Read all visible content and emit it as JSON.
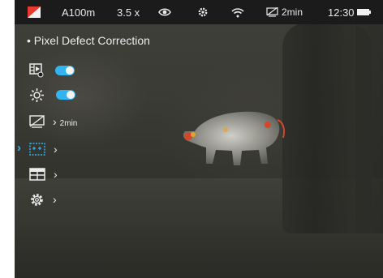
{
  "status_bar": {
    "model": "A100m",
    "zoom": "3.5 x",
    "timer": "2min",
    "clock": "12:30",
    "icons": [
      "palette-icon",
      "eye-icon",
      "gear-icon",
      "wifi-icon",
      "display-off-icon",
      "battery-icon"
    ]
  },
  "menu": {
    "title": "• Pixel Defect Correction",
    "items": [
      {
        "icon": "video-record-icon",
        "type": "toggle",
        "state": "on"
      },
      {
        "icon": "brightness-icon",
        "type": "toggle",
        "state": "on"
      },
      {
        "icon": "display-off-timer-icon",
        "type": "submenu",
        "value": "2min"
      },
      {
        "icon": "pixel-correction-icon",
        "type": "submenu",
        "selected": true
      },
      {
        "icon": "grid-icon",
        "type": "submenu"
      },
      {
        "icon": "settings-icon",
        "type": "submenu"
      }
    ],
    "accent_color": "#31b4ef"
  }
}
